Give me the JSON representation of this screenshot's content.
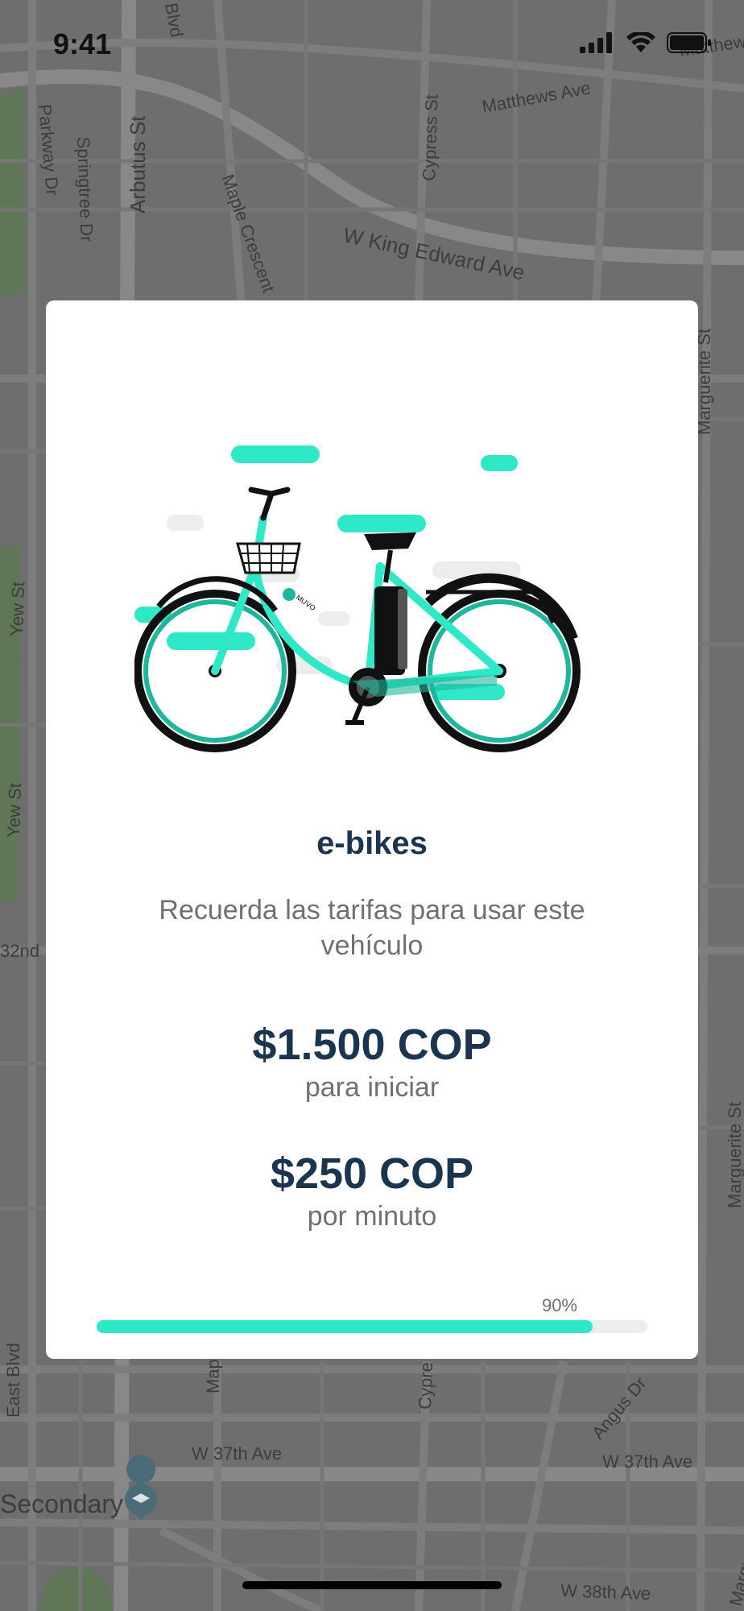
{
  "status_bar": {
    "time": "9:41",
    "icons": [
      "signal-icon",
      "wifi-icon",
      "battery-icon"
    ]
  },
  "map": {
    "labels": [
      "Blvd",
      "Matthews Ave",
      "Matthew",
      "Parkway Dr",
      "Springtree Dr",
      "Arbutus St",
      "Maple Crescent",
      "Cypress St",
      "W King Edward Ave",
      "Marguerite St",
      "Yew St",
      "Yew St",
      "32nd",
      "East Blvd",
      "Map",
      "Cypre",
      "W 37th Ave",
      "W 37th Ave",
      "Angus Dr",
      "Secondary",
      "W 38th Ave",
      "Marguerite St",
      "Marguerite St"
    ]
  },
  "modal": {
    "title": "e-bikes",
    "subtitle": "Recuerda las tarifas para usar este vehículo",
    "prices": [
      {
        "amount": "$1.500 COP",
        "label": "para iniciar"
      },
      {
        "amount": "$250 COP",
        "label": "por minuto"
      }
    ],
    "progress": {
      "value": 0.9,
      "label": "90%"
    },
    "bike_brand": "MUVO"
  },
  "colors": {
    "accent": "#2ee8c7",
    "title": "#1b3550",
    "muted": "#707070",
    "overlay": "#6f6f6f"
  }
}
